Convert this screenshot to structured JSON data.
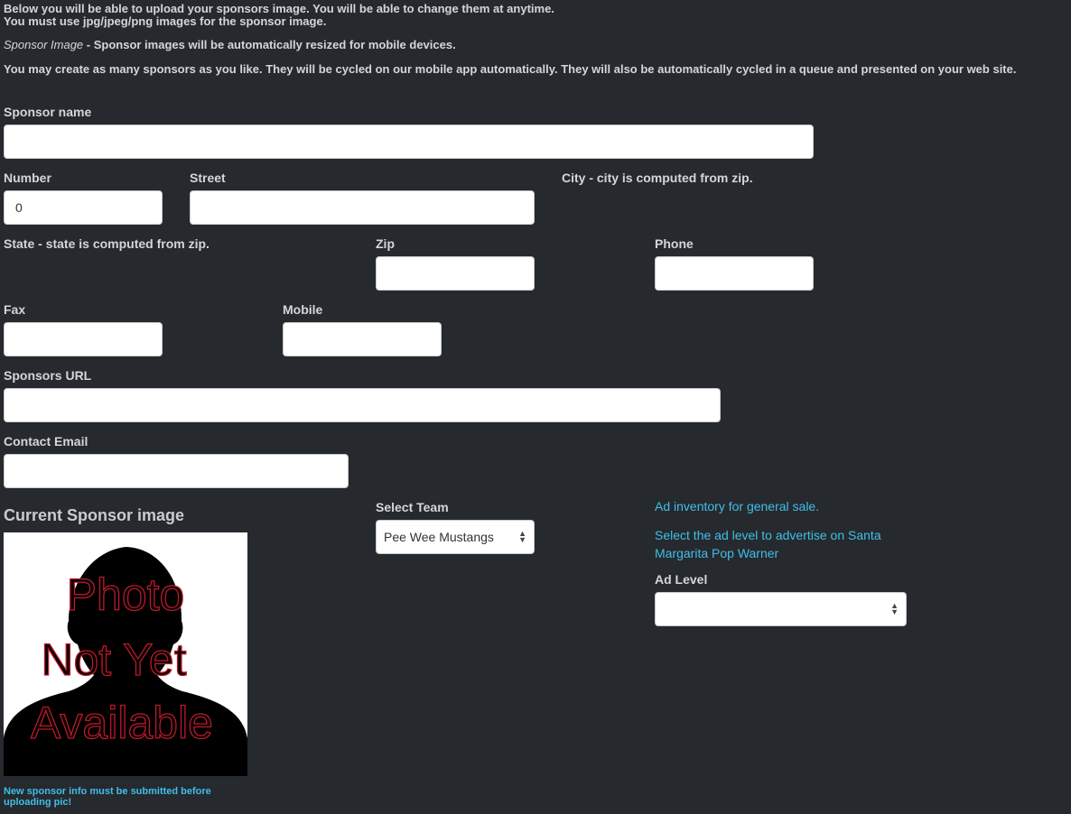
{
  "intro": {
    "line1": "Below you will be able to upload your sponsors image. You will be able to change them at anytime.",
    "line2": "You must use jpg/jpeg/png images for the sponsor image.",
    "sponsor_image_label": "Sponsor Image",
    "sponsor_image_text": " - Sponsor images will be automatically resized for mobile devices.",
    "cycle_text": "You may create as many sponsors as you like. They will be cycled on our mobile app automatically. They will also be automatically cycled in a queue and presented on your web site."
  },
  "form": {
    "sponsor_name": {
      "label": "Sponsor name",
      "value": ""
    },
    "number": {
      "label": "Number",
      "value": "0"
    },
    "street": {
      "label": "Street",
      "value": ""
    },
    "city_note": "City - city is computed from zip.",
    "state_note": "State - state is computed from zip.",
    "zip": {
      "label": "Zip",
      "value": ""
    },
    "phone": {
      "label": "Phone",
      "value": ""
    },
    "fax": {
      "label": "Fax",
      "value": ""
    },
    "mobile": {
      "label": "Mobile",
      "value": ""
    },
    "url": {
      "label": "Sponsors URL",
      "value": ""
    },
    "email": {
      "label": "Contact Email",
      "value": ""
    },
    "team": {
      "label": "Select Team",
      "selected": "Pee Wee Mustangs"
    },
    "ad_level": {
      "label": "Ad Level",
      "selected": ""
    }
  },
  "image_section": {
    "heading": "Current Sponsor image",
    "placeholder_lines": [
      "Photo",
      "Not Yet",
      "Available"
    ],
    "note": "New sponsor info must be submitted before uploading pic!"
  },
  "ads": {
    "inventory_link": "Ad inventory for general sale.",
    "advertise_text": "Select the ad level to advertise on Santa Margarita Pop Warner"
  },
  "colors": {
    "background": "#26292e",
    "link": "#3fbfe9",
    "placeholder_text": "#c0182a"
  }
}
